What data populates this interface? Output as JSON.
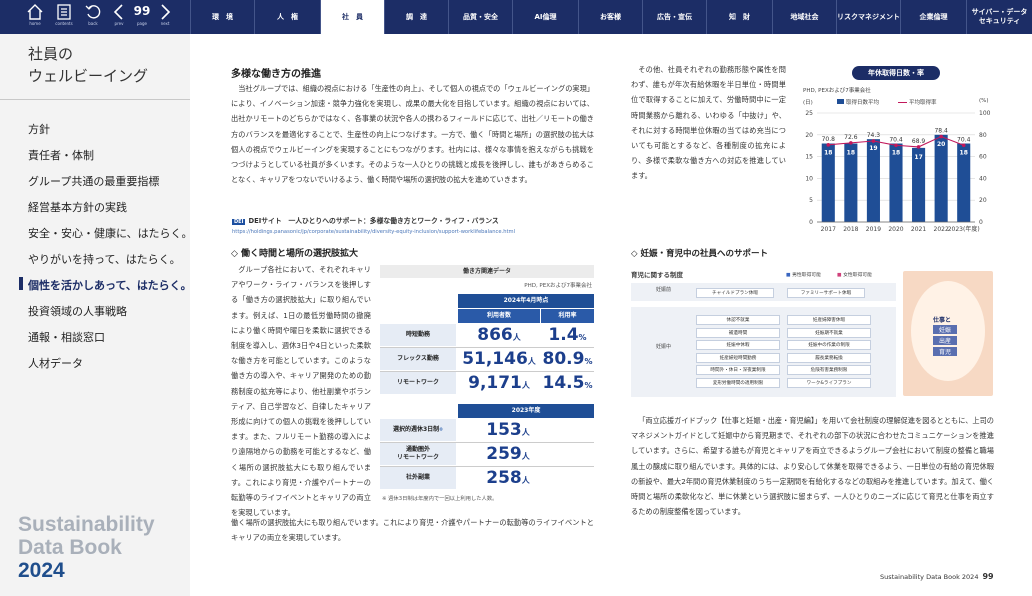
{
  "toolbar": {
    "home_label": "home",
    "contents_label": "contents",
    "back_label": "back",
    "prev_label": "prev",
    "page_number": "99",
    "page_label": "page",
    "next_label": "next"
  },
  "nav_tabs": [
    {
      "label": "環　境"
    },
    {
      "label": "人　権"
    },
    {
      "label": "社　員"
    },
    {
      "label": "調　達"
    },
    {
      "label": "品質・安全"
    },
    {
      "label": "AI倫理"
    },
    {
      "label": "お客様"
    },
    {
      "label": "広告・宣伝"
    },
    {
      "label": "知　財"
    },
    {
      "label": "地域社会"
    },
    {
      "label": "リスクマネジメント"
    },
    {
      "label": "企業倫理"
    },
    {
      "label": "サイバー・データセキュリティ"
    }
  ],
  "sidebar": {
    "title_line1": "社員の",
    "title_line2": "ウェルビーイング",
    "items": [
      {
        "label": "方針"
      },
      {
        "label": "責任者・体制"
      },
      {
        "label": "グループ共通の最重要指標"
      },
      {
        "label": "経営基本方針の実践"
      },
      {
        "label": "安全・安心・健康に、はたらく。"
      },
      {
        "label": "やりがいを持って、はたらく。"
      },
      {
        "label": "個性を活かしあって、はたらく。"
      },
      {
        "label": "投資領域の人事戦略"
      },
      {
        "label": "通報・相談窓口"
      },
      {
        "label": "人材データ"
      }
    ],
    "brand_line1": "Sustainability",
    "brand_line2": "Data Book",
    "brand_year": "2024"
  },
  "main": {
    "heading1": "多様な働き方の推進",
    "para1": "当社グループでは、組織の視点における「生産性の向上」、そして個人の視点での「ウェルビーイングの実現」により、イノベーション加速・競争力強化を実現し、成果の最大化を目指しています。組織の視点においては、出社かリモートのどちらかではなく、各事業の状況や各人の携わるフィールドに応じて、出社／リモートの働き方のバランスを最適化することで、生産性の向上につなげます。一方で、働く「時間と場所」の選択肢の拡大は個人の視点でウェルビーイングを実現することにもつながります。社内には、様々な事情を抱えながらも挑戦をつづけようとしている社員が多くいます。そのような一人ひとりの挑戦と成長を後押しし、誰もがあきらめることなく、キャリアをつないでいけるよう、働く時間や場所の選択肢の拡大を進めていきます。",
    "link_tag": "DEI",
    "link_title": "DEIサイト　一人ひとりへのサポート：多様な働き方とワーク・ライフ・バランス",
    "link_url": "https://holdings.panasonic/jp/corporate/sustainability/diversity-equity-inclusion/support-worklifebalance.html",
    "heading2": "◇ 働く時間と場所の選択肢拡大",
    "para2": "グループ各社において、それぞれキャリアやワーク・ライフ・バランスを後押しする「働き方の選択肢拡大」に取り組んでいます。例えば、1日の最低労働時間の撤廃により働く時間や曜日を柔軟に選択できる制度を導入し、週休3日や4日といった柔軟な働き方を可能としています。このような働き方の導入や、キャリア開発のための勤務制度の拡充等により、他社副業やボランティア、自己学習など、自律したキャリア形成に向けての個人の挑戦を後押ししています。また、フルリモート勤務の導入により遠隔地からの勤務を可能とするなど、働く場所の選択肢拡大にも取り組んでいます。これにより育児・介護やパートナーの転勤等のライフイベントとキャリアの両立を実現しています。"
  },
  "table": {
    "title": "働き方関連データ",
    "subtitle": "PHD, PEXおよび7事業会社",
    "year1": "2024年4月時点",
    "col_users": "利用者数",
    "col_rate": "利用率",
    "rows1": [
      {
        "label": "時短勤務",
        "users": "866",
        "rate": "1.4"
      },
      {
        "label": "フレックス勤務",
        "users": "51,146",
        "rate": "80.9"
      },
      {
        "label": "リモートワーク",
        "users": "9,171",
        "rate": "14.5"
      }
    ],
    "unit_person": "人",
    "unit_pct": "%",
    "year2": "2023年度",
    "rows2": [
      {
        "label": "選択的週休3日制",
        "mark": "※",
        "users": "153"
      },
      {
        "label_l1": "通勤圏外",
        "label_l2": "リモートワーク",
        "users": "259"
      },
      {
        "label": "社外副業",
        "users": "258"
      }
    ],
    "note": "※ 週休3日制は年度内で一回以上利用した人数。"
  },
  "right": {
    "para3": "その他、社員それぞれの勤務形態や属性を問わず、誰もが年次有給休暇を半日単位・時間単位で取得することに加えて、労働時間中に一定時間業務から離れる、いわゆる「中抜け」や、それに対する時間単位休暇の当てはめ充当についても可能とするなど、各種制度の拡充により、多様で柔軟な働き方への対応を推進しています。",
    "heading3": "◇ 妊娠・育児中の社員へのサポート",
    "diagram_title": "育児に関する制度",
    "legend_male": "男性取得可能",
    "legend_female": "女性取得可能",
    "phase_before": "妊娠前",
    "phase_during": "妊娠中",
    "before_items": [
      "チャイルドプラン休暇",
      "ファミリーサポート休暇"
    ],
    "left_items": [
      "休認不就業",
      "補遺時間",
      "妊娠中休暇",
      "妊産婦短時間勤務",
      "時間外・休日・深夜業制限",
      "変形労働時間の適用制限"
    ],
    "right_items": [
      "妊産婦障害休暇",
      "妊娠期不就業",
      "妊娠中の作業の制限",
      "履長業務転換",
      "危険有害業務制限",
      "ワーク&ライフプラン"
    ],
    "para4": "「両立応援ガイドブック【仕事と妊娠・出産・育児編】」を用いて会社制度の理解促進を図るとともに、上司のマネジメントガイドとして妊娠中から育児期まで、それぞれの部下の状況に合わせたコミュニケーションを推進しています。さらに、希望する誰もが育児とキャリアを両立できるようグループ会社において制度の整備と職場風土の醸成に取り組んでいます。具体的には、より安心して休業を取得できるよう、一日単位の有給の育児休暇の新設や、最大2年間の育児休業制度のうち一定期間を有給化するなどの取組みを推進しています。加えて、働く時間と場所の柔軟化など、単に休業という選択肢に留まらず、一人ひとりのニーズに応じて育児と仕事を両立するための制度整備を図っています。",
    "brochure_t1": "仕事と",
    "brochure_t2": "妊娠",
    "brochure_t3": "出産",
    "brochure_t4": "育児"
  },
  "chart_data": {
    "type": "bar",
    "title": "年休取得日数・率",
    "subtitle": "PHD, PEXおよび7事業会社",
    "categories": [
      "2017",
      "2018",
      "2019",
      "2020",
      "2021",
      "2022",
      "2023"
    ],
    "x_unit": "(年度)",
    "y_left_unit": "(日)",
    "y_right_unit": "(%)",
    "ylim_left": [
      0,
      25
    ],
    "ylim_right": [
      0,
      100
    ],
    "yticks_left": [
      0,
      5,
      10,
      15,
      20,
      25
    ],
    "yticks_right": [
      0,
      20,
      40,
      60,
      80,
      100
    ],
    "series": [
      {
        "name": "取得日数平均",
        "kind": "bar",
        "axis": "left",
        "color": "#1f4e96",
        "values": [
          18,
          18,
          19,
          18,
          17,
          20,
          18
        ]
      },
      {
        "name": "平均取得率",
        "kind": "line",
        "axis": "right",
        "color": "#c2185b",
        "values": [
          70.8,
          72.6,
          74.3,
          70.4,
          68.9,
          78.4,
          70.4
        ]
      }
    ]
  },
  "footer": {
    "title": "Sustainability Data Book 2024",
    "page": "99"
  }
}
